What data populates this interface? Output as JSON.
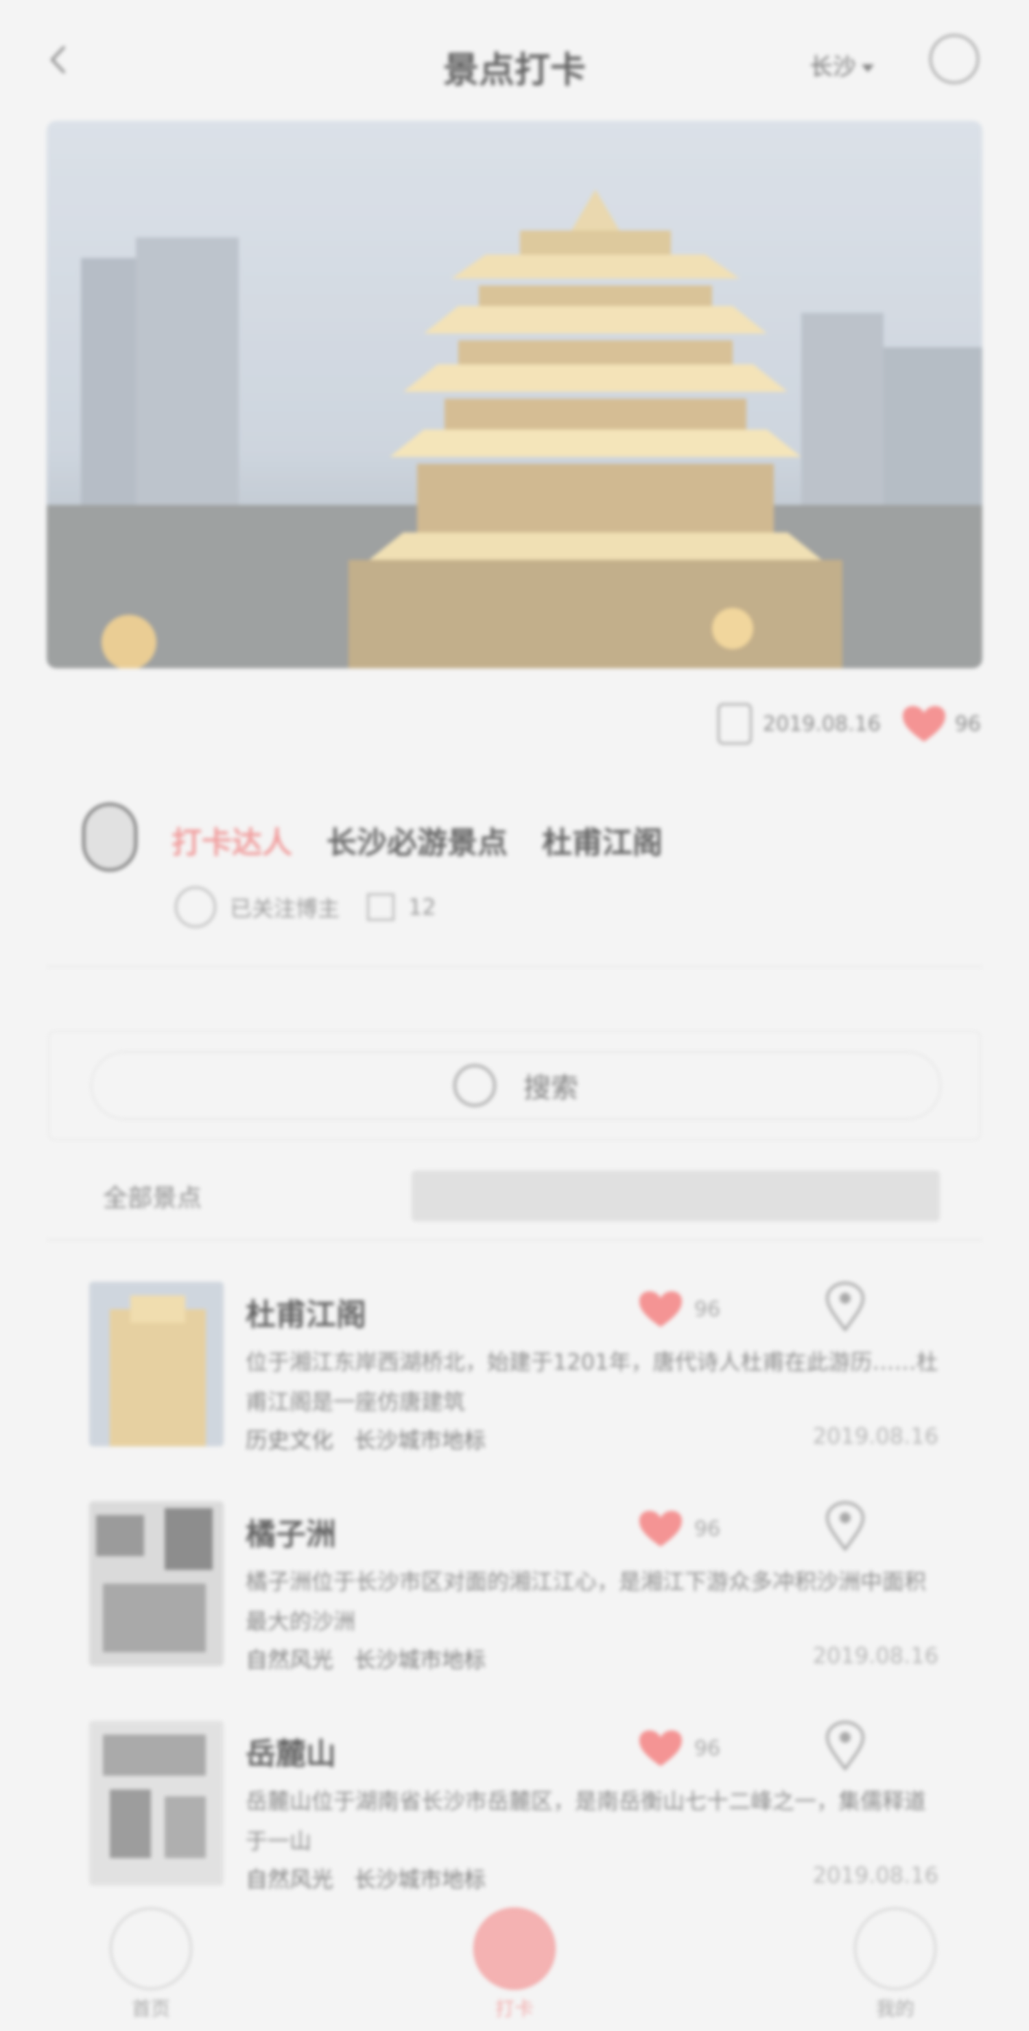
{
  "nav": {
    "title": "景点打卡",
    "city": "长沙"
  },
  "hero": {
    "alt_icon": "tower-photo"
  },
  "stats": {
    "views": "2019.08.16",
    "likes": "96"
  },
  "author": {
    "name": "打卡达人",
    "tag1": "长沙必游景点",
    "tag2": "杜甫江阁",
    "follow": "已关注博主",
    "count": "12"
  },
  "search": {
    "placeholder": "搜索"
  },
  "tabs": {
    "left": "全部景点"
  },
  "items": [
    {
      "name": "杜甫江阁",
      "likes": "96",
      "desc": "位于湘江东岸西湖桥北，始建于1201年，唐代诗人杜甫在此游历……杜甫江阁是一座仿唐建筑",
      "category": "历史文化",
      "tags": "长沙城市地标",
      "date": "2019.08.16"
    },
    {
      "name": "橘子洲",
      "likes": "96",
      "desc": "橘子洲位于长沙市区对面的湘江江心，是湘江下游众多冲积沙洲中面积最大的沙洲",
      "category": "自然风光",
      "tags": "长沙城市地标",
      "date": "2019.08.16"
    },
    {
      "name": "岳麓山",
      "likes": "96",
      "desc": "岳麓山位于湖南省长沙市岳麓区，是南岳衡山七十二峰之一，集儒释道于一山",
      "category": "自然风光",
      "tags": "长沙城市地标",
      "date": "2019.08.16"
    }
  ],
  "tabbar": {
    "home": "首页",
    "checkin": "打卡",
    "mine": "我的"
  },
  "colors": {
    "accent": "#f29a9a",
    "heart": "#f47f7f"
  }
}
